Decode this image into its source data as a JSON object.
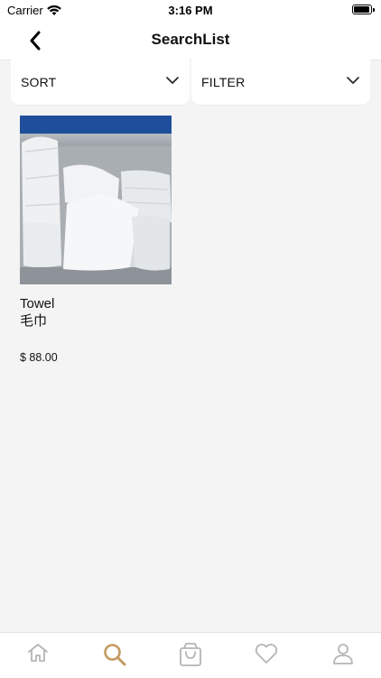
{
  "status_bar": {
    "carrier": "Carrier",
    "time": "3:16 PM"
  },
  "nav": {
    "title": "SearchList"
  },
  "sort": {
    "label": "SORT"
  },
  "filter": {
    "label": "FILTER"
  },
  "products": [
    {
      "name": "Towel",
      "name_cn": "毛巾",
      "price": "$ 88.00"
    }
  ],
  "tabs": [
    {
      "icon": "home-icon",
      "active": false
    },
    {
      "icon": "search-icon",
      "active": true
    },
    {
      "icon": "bag-icon",
      "active": false
    },
    {
      "icon": "heart-icon",
      "active": false
    },
    {
      "icon": "profile-icon",
      "active": false
    }
  ],
  "colors": {
    "accent": "#c49a5f",
    "inactive_icon": "#b5b5b5",
    "background": "#f4f4f4"
  }
}
